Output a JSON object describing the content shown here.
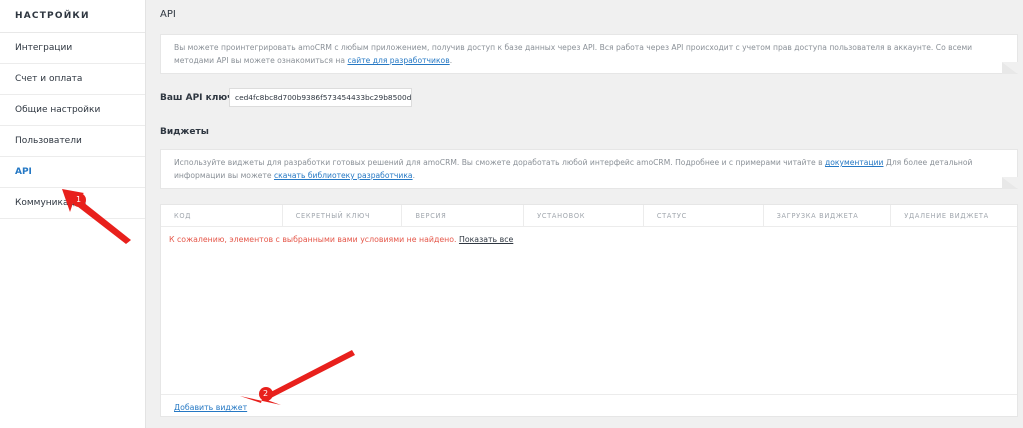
{
  "sidebar": {
    "title": "НАСТРОЙКИ",
    "items": [
      {
        "label": "Интеграции"
      },
      {
        "label": "Счет и оплата"
      },
      {
        "label": "Общие настройки"
      },
      {
        "label": "Пользователи"
      },
      {
        "label": "API",
        "active": true
      },
      {
        "label": "Коммуникации"
      }
    ]
  },
  "main": {
    "title": "API",
    "api_note": {
      "text": "Вы можете проинтегрировать amoCRM с любым приложением, получив доступ к базе данных через API. Вся работа через API происходит с учетом прав доступа пользователя в аккаунте. Со всеми методами API вы можете ознакомиться на ",
      "link": "сайте для разработчиков",
      "suffix": "."
    },
    "api_key_label": "Ваш API ключ",
    "api_key_value": "ced4fc8bc8d700b9386f573454433bc29b8500d9",
    "widgets_title": "Виджеты",
    "widgets_note": {
      "text": "Используйте виджеты для разработки готовых решений для amoCRM. Вы сможете доработать любой интерфейс amoCRM. Подробнее и с примерами читайте в ",
      "link1": "документации",
      "middle": " Для более детальной информации вы можете ",
      "link2": "скачать библиотеку разработчика",
      "suffix": "."
    },
    "table": {
      "columns": [
        "КОД",
        "СЕКРЕТНЫЙ КЛЮЧ",
        "ВЕРСИЯ",
        "УСТАНОВОК",
        "СТАТУС",
        "ЗАГРУЗКА ВИДЖЕТА",
        "УДАЛЕНИЕ ВИДЖЕТА"
      ],
      "empty_message": "К сожалению, элементов с выбранными вами условиями не найдено.",
      "show_all": "Показать все",
      "add_widget": "Добавить виджет"
    }
  },
  "annotations": {
    "arrow_color": "#e8201c",
    "labels": [
      "1",
      "2"
    ]
  },
  "colors": {
    "accent": "#2578c4",
    "error": "#e5574a"
  }
}
